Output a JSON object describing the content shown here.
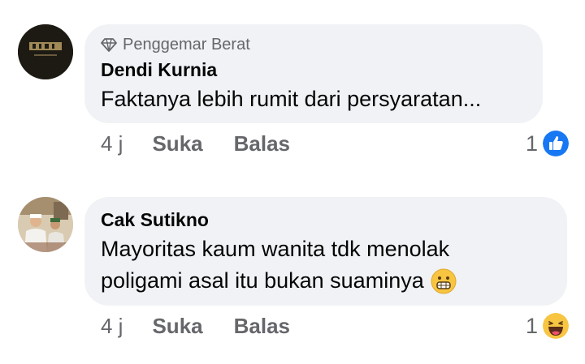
{
  "comments": [
    {
      "badge_label": "Penggemar Berat",
      "badge_icon": "diamond-icon",
      "author": "Dendi Kurnia",
      "text_lines": [
        "Faktanya lebih rumit dari persyaratan..."
      ],
      "time": "4 j",
      "like_label": "Suka",
      "reply_label": "Balas",
      "reaction_count": "1",
      "reaction_icon": "like-icon"
    },
    {
      "author": "Cak Sutikno",
      "text_lines": [
        "Mayoritas kaum wanita tdk menolak",
        "poligami asal itu bukan suaminya"
      ],
      "inline_emoji": "grinning-face-icon",
      "time": "4 j",
      "like_label": "Suka",
      "reply_label": "Balas",
      "reaction_count": "1",
      "reaction_icon": "haha-icon"
    }
  ],
  "colors": {
    "bubble": "#f0f2f5",
    "meta_text": "#65676b",
    "like_blue": "#1877f2",
    "haha_yellow": "#f7c541"
  }
}
